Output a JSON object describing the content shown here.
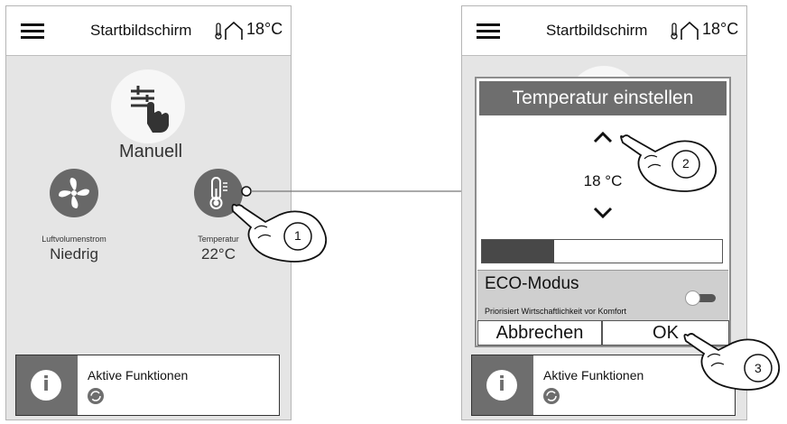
{
  "left_screen": {
    "header": {
      "title": "Startbildschirm",
      "temperature": "18°C"
    },
    "mode_label": "Manuell",
    "airflow": {
      "label": "Luftvolumenstrom",
      "value": "Niedrig"
    },
    "temperature": {
      "label": "Temperatur",
      "value": "22°C"
    },
    "active_functions": "Aktive Funktionen"
  },
  "right_screen": {
    "header": {
      "title": "Startbildschirm",
      "temperature": "18°C"
    },
    "dialog": {
      "title": "Temperatur einstellen",
      "value": "18 °C",
      "level_fraction": 0.3,
      "eco_title": "ECO-Modus",
      "eco_subtitle": "Priorisiert Wirtschaftlichkeit vor Komfort",
      "cancel": "Abbrechen",
      "ok": "OK"
    },
    "active_functions": "Aktive Funktionen"
  },
  "callouts": [
    "1",
    "2",
    "3"
  ],
  "colors": {
    "dark_gray": "#6e6e6e",
    "background": "#e5e5e5",
    "eco_panel": "#cfcfcf"
  }
}
